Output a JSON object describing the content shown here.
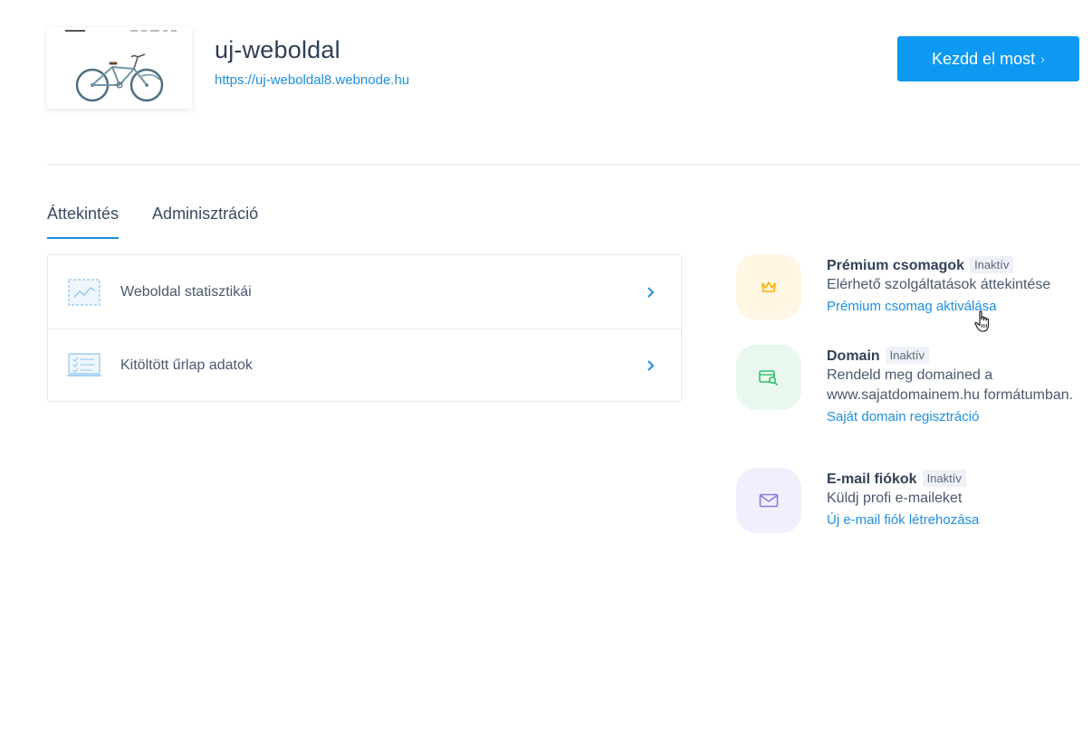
{
  "site": {
    "title": "uj-weboldal",
    "url": "https://uj-weboldal8.webnode.hu"
  },
  "cta": {
    "label": "Kezdd el most",
    "chevron": "›"
  },
  "tabs": [
    {
      "label": "Áttekintés",
      "active": true
    },
    {
      "label": "Adminisztráció",
      "active": false
    }
  ],
  "list": [
    {
      "label": "Weboldal statisztikái",
      "icon": "chart-icon"
    },
    {
      "label": "Kitöltött űrlap adatok",
      "icon": "form-icon"
    }
  ],
  "features": [
    {
      "title": "Prémium csomagok",
      "badge": "Inaktív",
      "desc": "Elérhető szolgáltatások áttekintése",
      "link": "Prémium csomag aktiválása",
      "icon": "crown-icon",
      "icon_bg": "#fff6e3",
      "icon_color": "#f5b400"
    },
    {
      "title": "Domain",
      "badge": "Inaktív",
      "desc": "Rendeld meg domained a www.sajatdomainem.hu formátumban.",
      "link": "Saját domain regisztráció",
      "icon": "domain-search-icon",
      "icon_bg": "#e9f8ef",
      "icon_color": "#2fbf6b"
    },
    {
      "title": "E-mail fiókok",
      "badge": "Inaktív",
      "desc": "Küldj profi e-maileket",
      "link": "Új e-mail fiók létrehozása",
      "icon": "envelope-icon",
      "icon_bg": "#f1effd",
      "icon_color": "#8a78e6"
    }
  ],
  "colors": {
    "accent": "#1e8fe1",
    "cta": "#0d99f2"
  }
}
